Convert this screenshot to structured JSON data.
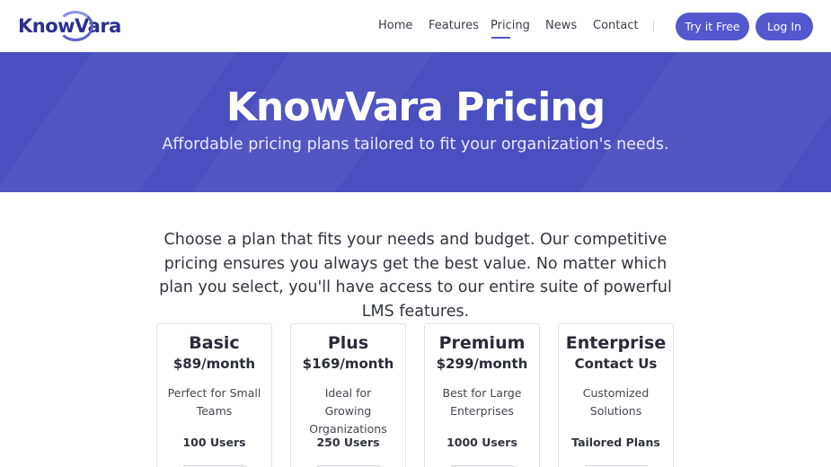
{
  "brand": {
    "logo_text": "KnowVara"
  },
  "nav": {
    "items": [
      {
        "label": "Home"
      },
      {
        "label": "Features"
      },
      {
        "label": "Pricing"
      },
      {
        "label": "News"
      },
      {
        "label": "Contact"
      }
    ],
    "active": "Pricing",
    "try_label": "Try it Free",
    "login_label": "Log In"
  },
  "hero": {
    "title": "KnowVara Pricing",
    "subtitle": "Affordable pricing plans tailored to fit your organization's needs."
  },
  "intro": {
    "text": "Choose a plan that fits your needs and budget. Our competitive pricing ensures you always get the best value. No matter which plan you select, you'll have access to our entire suite of powerful LMS features."
  },
  "plans": [
    {
      "name": "Basic",
      "price": "$89/month",
      "desc": "Perfect for Small Teams",
      "users": "100 Users"
    },
    {
      "name": "Plus",
      "price": "$169/month",
      "desc": "Ideal for Growing Organizations",
      "users": "250 Users"
    },
    {
      "name": "Premium",
      "price": "$299/month",
      "desc": "Best for Large Enterprises",
      "users": "1000 Users"
    },
    {
      "name": "Enterprise",
      "price": "Contact Us",
      "desc": "Customized Solutions",
      "users": "Tailored Plans"
    }
  ],
  "colors": {
    "primary": "#5359cc",
    "hero": "#4a4fc0",
    "text": "#2d2d3a"
  }
}
